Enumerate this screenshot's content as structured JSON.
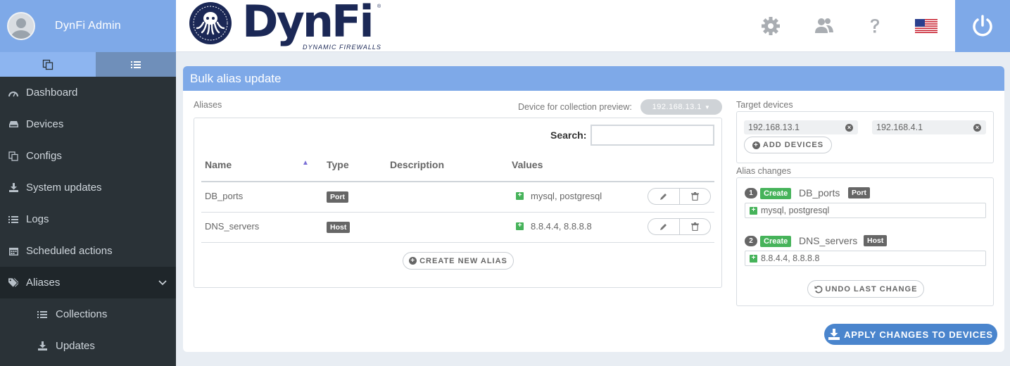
{
  "app": {
    "user": "DynFi Admin",
    "logo_text": "DynFi",
    "logo_subtitle": "DYNAMIC FIREWALLS",
    "logo_reg": "®"
  },
  "sidebar": {
    "items": [
      {
        "label": "Dashboard",
        "icon": "dashboard-icon"
      },
      {
        "label": "Devices",
        "icon": "server-icon"
      },
      {
        "label": "Configs",
        "icon": "copy-icon"
      },
      {
        "label": "System updates",
        "icon": "download-icon"
      },
      {
        "label": "Logs",
        "icon": "list-icon"
      },
      {
        "label": "Scheduled actions",
        "icon": "calendar-icon"
      },
      {
        "label": "Aliases",
        "icon": "tags-icon",
        "active": true
      }
    ],
    "subitems": [
      {
        "label": "Collections",
        "icon": "list-icon"
      },
      {
        "label": "Updates",
        "icon": "download-icon"
      }
    ]
  },
  "header": {
    "icons": [
      "gear-icon",
      "users-icon",
      "help-icon",
      "flag-icon",
      "power-icon"
    ]
  },
  "card": {
    "title": "Bulk alias update",
    "aliases_label": "Aliases",
    "device_preview_label": "Device for collection preview:",
    "device_preview_value": "192.168.13.1",
    "search_label": "Search:",
    "search_value": "",
    "columns": [
      "Name",
      "Type",
      "Description",
      "Values"
    ],
    "sort_indicator": "▲",
    "rows": [
      {
        "name": "DB_ports",
        "type": "Port",
        "description": "",
        "values": "mysql, postgresql"
      },
      {
        "name": "DNS_servers",
        "type": "Host",
        "description": "",
        "values": "8.8.4.4, 8.8.8.8"
      }
    ],
    "create_alias": "CREATE NEW ALIAS",
    "target_label": "Target devices",
    "targets": [
      "192.168.13.1",
      "192.168.4.1"
    ],
    "add_devices": "ADD DEVICES",
    "changes_label": "Alias changes",
    "changes": [
      {
        "num": "1",
        "action": "Create",
        "name": "DB_ports",
        "type": "Port",
        "values": "mysql, postgresql"
      },
      {
        "num": "2",
        "action": "Create",
        "name": "DNS_servers",
        "type": "Host",
        "values": "8.8.4.4, 8.8.8.8"
      }
    ],
    "undo": "UNDO LAST CHANGE",
    "apply": "APPLY CHANGES TO DEVICES"
  },
  "colors": {
    "accent": "#7ea9e8",
    "sidebar": "#2a3237",
    "success": "#46b35a",
    "logo": "#1b2856",
    "apply": "#4a85cd"
  }
}
